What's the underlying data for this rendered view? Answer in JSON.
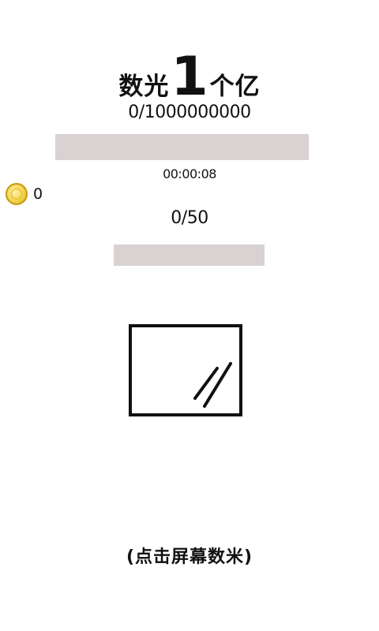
{
  "title": {
    "before": "数光",
    "big": "1",
    "after": "个亿"
  },
  "progress": {
    "count_text": "0/1000000000",
    "current": 0,
    "total": 1000000000
  },
  "timer": "00:00:08",
  "coins": {
    "icon": "coin-icon",
    "count": "0"
  },
  "stage": {
    "count_text": "0/50",
    "current": 0,
    "total": 50
  },
  "target": {
    "icon": "glass-frame-icon"
  },
  "hint": "(点击屏幕数米)",
  "colors": {
    "background": "#ffffff",
    "text": "#111111",
    "bar": "#d9d2d2",
    "coin": "#f3d44e"
  }
}
